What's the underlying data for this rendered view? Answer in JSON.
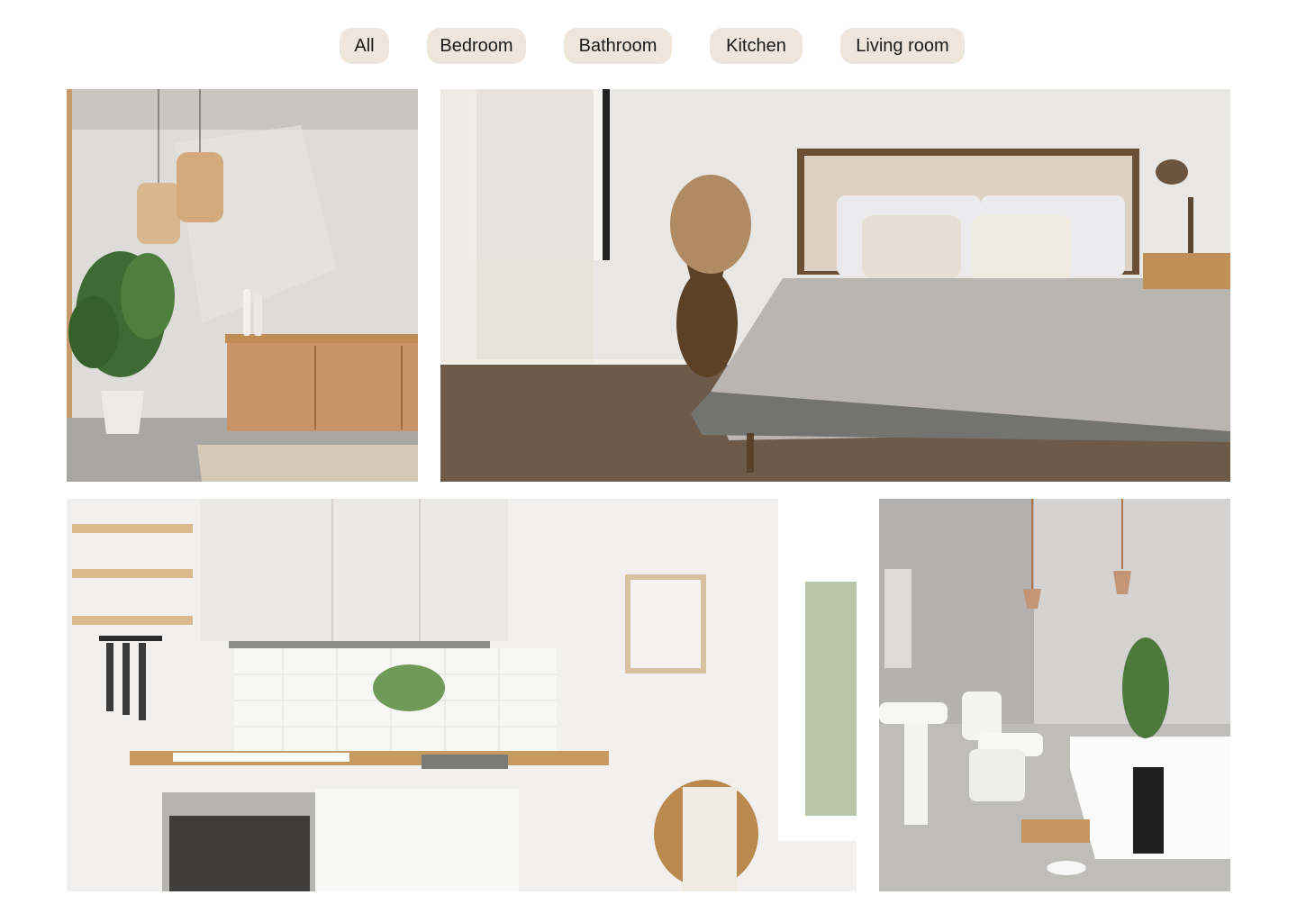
{
  "filters": {
    "items": [
      {
        "label": "All"
      },
      {
        "label": "Bedroom"
      },
      {
        "label": "Bathroom"
      },
      {
        "label": "Kitchen"
      },
      {
        "label": "Living room"
      }
    ]
  },
  "colors": {
    "chip_background": "#EEE6DC",
    "page_background": "#FFFFFF",
    "chip_text": "#1A1A1A"
  }
}
